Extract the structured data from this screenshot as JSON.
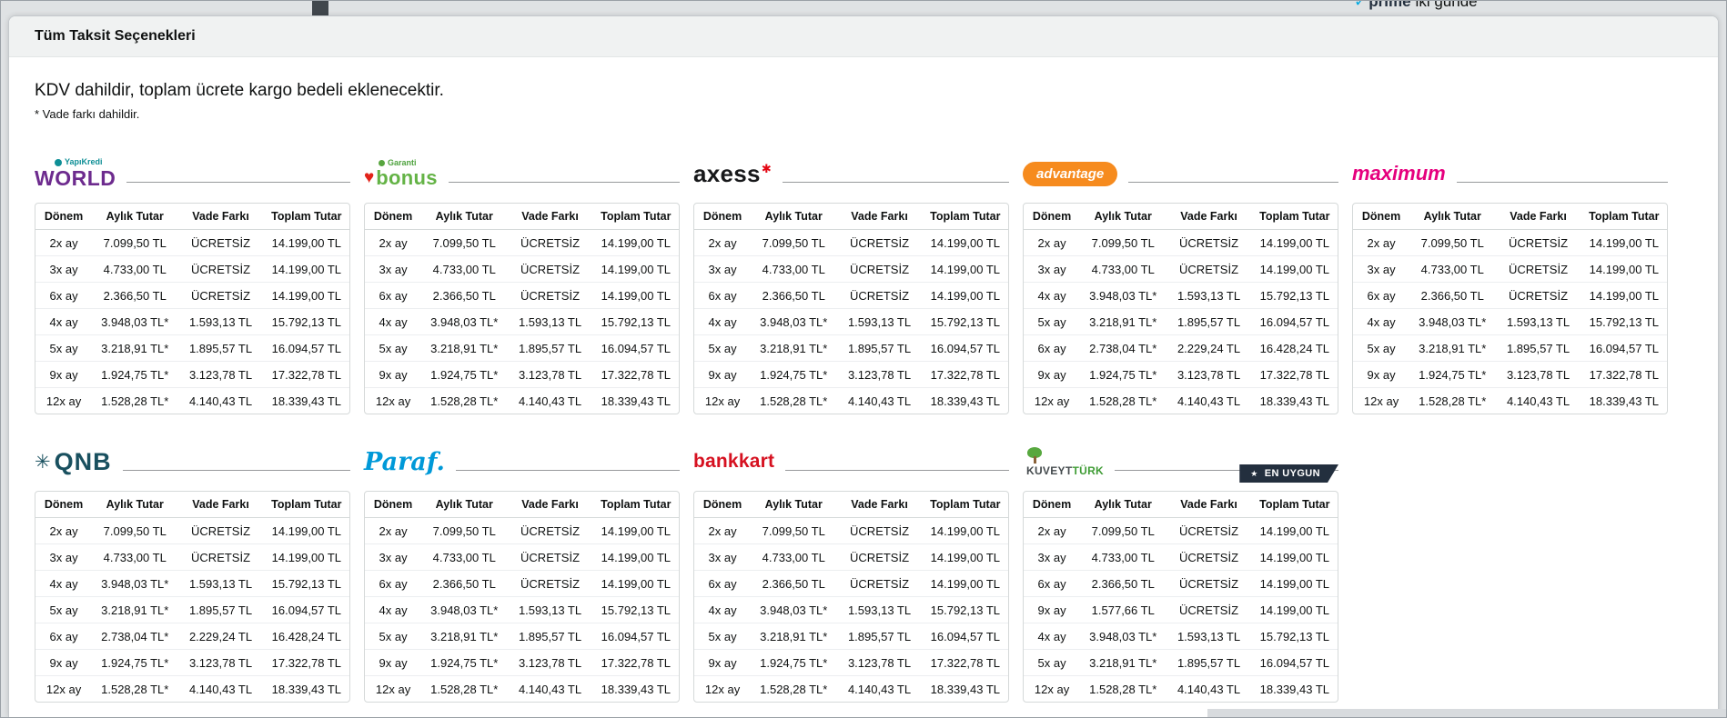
{
  "background_page": {
    "prime_label": "prime",
    "delivery_label": "iki günde"
  },
  "modal": {
    "title": "Tüm Taksit Seçenekleri",
    "subtitle": "KDV dahildir, toplam ücrete kargo bedeli eklenecektir.",
    "note": "* Vade farkı dahildir."
  },
  "table_headers": [
    "Dönem",
    "Aylık Tutar",
    "Vade Farkı",
    "Toplam Tutar"
  ],
  "colors": {
    "world_purple": "#6d2b8e",
    "yapikredi_teal": "#0e8f96",
    "bonus_green": "#64b346",
    "heart_red": "#e2231a",
    "axess_black": "#17181a",
    "axess_red": "#e30613",
    "advantage_orange": "#f68b1e",
    "maximum_magenta": "#e6007e",
    "qnb_teal": "#19505f",
    "paraf_blue": "#0099d8",
    "bankkart_red": "#d61120",
    "kuveytturk_green": "#3f9c35",
    "badge_navy": "#232f3e",
    "header_bar_gray": "#f0f2f2",
    "table_border_gray": "#d5d9d9"
  },
  "banks": [
    {
      "id": "world",
      "logo": {
        "brand": "YapıKredi",
        "name": "WORLD"
      },
      "rows": [
        [
          "2x ay",
          "7.099,50 TL",
          "ÜCRETSİZ",
          "14.199,00 TL"
        ],
        [
          "3x ay",
          "4.733,00 TL",
          "ÜCRETSİZ",
          "14.199,00 TL"
        ],
        [
          "6x ay",
          "2.366,50 TL",
          "ÜCRETSİZ",
          "14.199,00 TL"
        ],
        [
          "4x ay",
          "3.948,03 TL*",
          "1.593,13 TL",
          "15.792,13 TL"
        ],
        [
          "5x ay",
          "3.218,91 TL*",
          "1.895,57 TL",
          "16.094,57 TL"
        ],
        [
          "9x ay",
          "1.924,75 TL*",
          "3.123,78 TL",
          "17.322,78 TL"
        ],
        [
          "12x ay",
          "1.528,28 TL*",
          "4.140,43 TL",
          "18.339,43 TL"
        ]
      ]
    },
    {
      "id": "bonus",
      "logo": {
        "brand": "Garanti",
        "name": "bonus",
        "heart": "♥"
      },
      "rows": [
        [
          "2x ay",
          "7.099,50 TL",
          "ÜCRETSİZ",
          "14.199,00 TL"
        ],
        [
          "3x ay",
          "4.733,00 TL",
          "ÜCRETSİZ",
          "14.199,00 TL"
        ],
        [
          "6x ay",
          "2.366,50 TL",
          "ÜCRETSİZ",
          "14.199,00 TL"
        ],
        [
          "4x ay",
          "3.948,03 TL*",
          "1.593,13 TL",
          "15.792,13 TL"
        ],
        [
          "5x ay",
          "3.218,91 TL*",
          "1.895,57 TL",
          "16.094,57 TL"
        ],
        [
          "9x ay",
          "1.924,75 TL*",
          "3.123,78 TL",
          "17.322,78 TL"
        ],
        [
          "12x ay",
          "1.528,28 TL*",
          "4.140,43 TL",
          "18.339,43 TL"
        ]
      ]
    },
    {
      "id": "axess",
      "logo": {
        "name": "axess",
        "spark": "✱"
      },
      "rows": [
        [
          "2x ay",
          "7.099,50 TL",
          "ÜCRETSİZ",
          "14.199,00 TL"
        ],
        [
          "3x ay",
          "4.733,00 TL",
          "ÜCRETSİZ",
          "14.199,00 TL"
        ],
        [
          "6x ay",
          "2.366,50 TL",
          "ÜCRETSİZ",
          "14.199,00 TL"
        ],
        [
          "4x ay",
          "3.948,03 TL*",
          "1.593,13 TL",
          "15.792,13 TL"
        ],
        [
          "5x ay",
          "3.218,91 TL*",
          "1.895,57 TL",
          "16.094,57 TL"
        ],
        [
          "9x ay",
          "1.924,75 TL*",
          "3.123,78 TL",
          "17.322,78 TL"
        ],
        [
          "12x ay",
          "1.528,28 TL*",
          "4.140,43 TL",
          "18.339,43 TL"
        ]
      ]
    },
    {
      "id": "advantage",
      "logo": {
        "name": "advantage"
      },
      "rows": [
        [
          "2x ay",
          "7.099,50 TL",
          "ÜCRETSİZ",
          "14.199,00 TL"
        ],
        [
          "3x ay",
          "4.733,00 TL",
          "ÜCRETSİZ",
          "14.199,00 TL"
        ],
        [
          "4x ay",
          "3.948,03 TL*",
          "1.593,13 TL",
          "15.792,13 TL"
        ],
        [
          "5x ay",
          "3.218,91 TL*",
          "1.895,57 TL",
          "16.094,57 TL"
        ],
        [
          "6x ay",
          "2.738,04 TL*",
          "2.229,24 TL",
          "16.428,24 TL"
        ],
        [
          "9x ay",
          "1.924,75 TL*",
          "3.123,78 TL",
          "17.322,78 TL"
        ],
        [
          "12x ay",
          "1.528,28 TL*",
          "4.140,43 TL",
          "18.339,43 TL"
        ]
      ]
    },
    {
      "id": "maximum",
      "logo": {
        "name": "maximum"
      },
      "rows": [
        [
          "2x ay",
          "7.099,50 TL",
          "ÜCRETSİZ",
          "14.199,00 TL"
        ],
        [
          "3x ay",
          "4.733,00 TL",
          "ÜCRETSİZ",
          "14.199,00 TL"
        ],
        [
          "6x ay",
          "2.366,50 TL",
          "ÜCRETSİZ",
          "14.199,00 TL"
        ],
        [
          "4x ay",
          "3.948,03 TL*",
          "1.593,13 TL",
          "15.792,13 TL"
        ],
        [
          "5x ay",
          "3.218,91 TL*",
          "1.895,57 TL",
          "16.094,57 TL"
        ],
        [
          "9x ay",
          "1.924,75 TL*",
          "3.123,78 TL",
          "17.322,78 TL"
        ],
        [
          "12x ay",
          "1.528,28 TL*",
          "4.140,43 TL",
          "18.339,43 TL"
        ]
      ]
    },
    {
      "id": "qnb",
      "logo": {
        "name": "QNB",
        "star": "✳"
      },
      "rows": [
        [
          "2x ay",
          "7.099,50 TL",
          "ÜCRETSİZ",
          "14.199,00 TL"
        ],
        [
          "3x ay",
          "4.733,00 TL",
          "ÜCRETSİZ",
          "14.199,00 TL"
        ],
        [
          "4x ay",
          "3.948,03 TL*",
          "1.593,13 TL",
          "15.792,13 TL"
        ],
        [
          "5x ay",
          "3.218,91 TL*",
          "1.895,57 TL",
          "16.094,57 TL"
        ],
        [
          "6x ay",
          "2.738,04 TL*",
          "2.229,24 TL",
          "16.428,24 TL"
        ],
        [
          "9x ay",
          "1.924,75 TL*",
          "3.123,78 TL",
          "17.322,78 TL"
        ],
        [
          "12x ay",
          "1.528,28 TL*",
          "4.140,43 TL",
          "18.339,43 TL"
        ]
      ]
    },
    {
      "id": "paraf",
      "logo": {
        "name": "Paraf."
      },
      "rows": [
        [
          "2x ay",
          "7.099,50 TL",
          "ÜCRETSİZ",
          "14.199,00 TL"
        ],
        [
          "3x ay",
          "4.733,00 TL",
          "ÜCRETSİZ",
          "14.199,00 TL"
        ],
        [
          "6x ay",
          "2.366,50 TL",
          "ÜCRETSİZ",
          "14.199,00 TL"
        ],
        [
          "4x ay",
          "3.948,03 TL*",
          "1.593,13 TL",
          "15.792,13 TL"
        ],
        [
          "5x ay",
          "3.218,91 TL*",
          "1.895,57 TL",
          "16.094,57 TL"
        ],
        [
          "9x ay",
          "1.924,75 TL*",
          "3.123,78 TL",
          "17.322,78 TL"
        ],
        [
          "12x ay",
          "1.528,28 TL*",
          "4.140,43 TL",
          "18.339,43 TL"
        ]
      ]
    },
    {
      "id": "bankkart",
      "logo": {
        "name": "bankkart"
      },
      "rows": [
        [
          "2x ay",
          "7.099,50 TL",
          "ÜCRETSİZ",
          "14.199,00 TL"
        ],
        [
          "3x ay",
          "4.733,00 TL",
          "ÜCRETSİZ",
          "14.199,00 TL"
        ],
        [
          "6x ay",
          "2.366,50 TL",
          "ÜCRETSİZ",
          "14.199,00 TL"
        ],
        [
          "4x ay",
          "3.948,03 TL*",
          "1.593,13 TL",
          "15.792,13 TL"
        ],
        [
          "5x ay",
          "3.218,91 TL*",
          "1.895,57 TL",
          "16.094,57 TL"
        ],
        [
          "9x ay",
          "1.924,75 TL*",
          "3.123,78 TL",
          "17.322,78 TL"
        ],
        [
          "12x ay",
          "1.528,28 TL*",
          "4.140,43 TL",
          "18.339,43 TL"
        ]
      ]
    },
    {
      "id": "kuveytturk",
      "logo": {
        "name_part1": "KUVEYT",
        "name_part2": "TÜRK"
      },
      "badge_star": "★",
      "badge": "EN UYGUN",
      "rows": [
        [
          "2x ay",
          "7.099,50 TL",
          "ÜCRETSİZ",
          "14.199,00 TL"
        ],
        [
          "3x ay",
          "4.733,00 TL",
          "ÜCRETSİZ",
          "14.199,00 TL"
        ],
        [
          "6x ay",
          "2.366,50 TL",
          "ÜCRETSİZ",
          "14.199,00 TL"
        ],
        [
          "9x ay",
          "1.577,66 TL",
          "ÜCRETSİZ",
          "14.199,00 TL"
        ],
        [
          "4x ay",
          "3.948,03 TL*",
          "1.593,13 TL",
          "15.792,13 TL"
        ],
        [
          "5x ay",
          "3.218,91 TL*",
          "1.895,57 TL",
          "16.094,57 TL"
        ],
        [
          "12x ay",
          "1.528,28 TL*",
          "4.140,43 TL",
          "18.339,43 TL"
        ]
      ]
    }
  ]
}
